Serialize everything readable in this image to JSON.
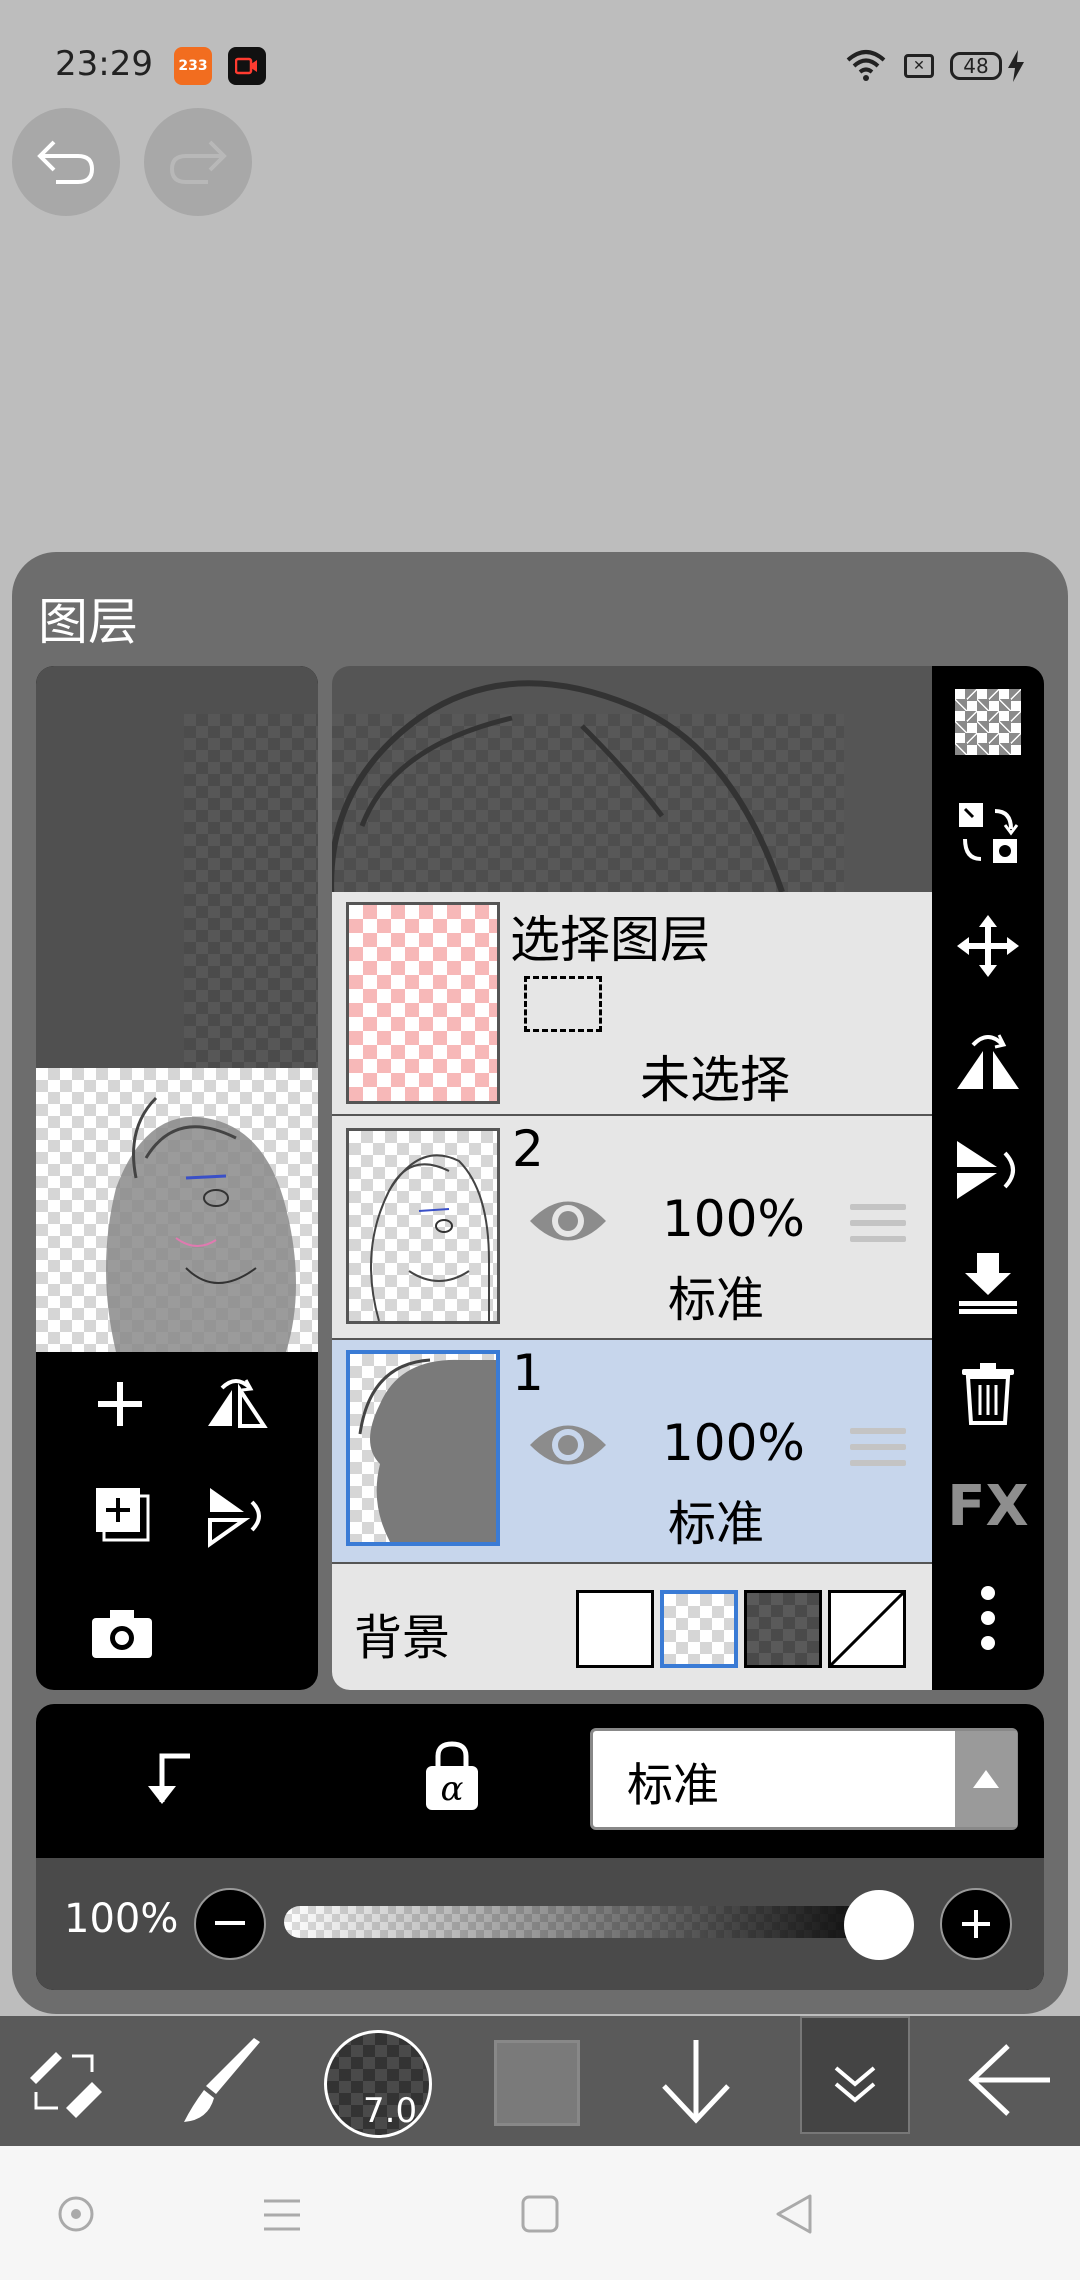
{
  "status_bar": {
    "time": "23:29",
    "app_badge_1": "233",
    "battery": "48"
  },
  "panel": {
    "title": "图层"
  },
  "selection_layer": {
    "title": "选择图层",
    "status": "未选择"
  },
  "layers": [
    {
      "name": "2",
      "opacity": "100%",
      "blend": "标准",
      "visible": true,
      "selected": false
    },
    {
      "name": "1",
      "opacity": "100%",
      "blend": "标准",
      "visible": true,
      "selected": true
    }
  ],
  "background": {
    "label": "背景",
    "swatches": [
      "white",
      "transparent",
      "dark-checker",
      "none"
    ],
    "selected_index": 1
  },
  "blend_mode": {
    "value": "标准"
  },
  "opacity": {
    "label": "100%",
    "value": 1.0
  },
  "brush": {
    "size": "7.0"
  },
  "colors": {
    "accent_blue": "#3a7bd5",
    "selected_row": "#c7d6ec",
    "panel_bg": "#6d6d6d",
    "current_color": "#7a7a7a"
  }
}
